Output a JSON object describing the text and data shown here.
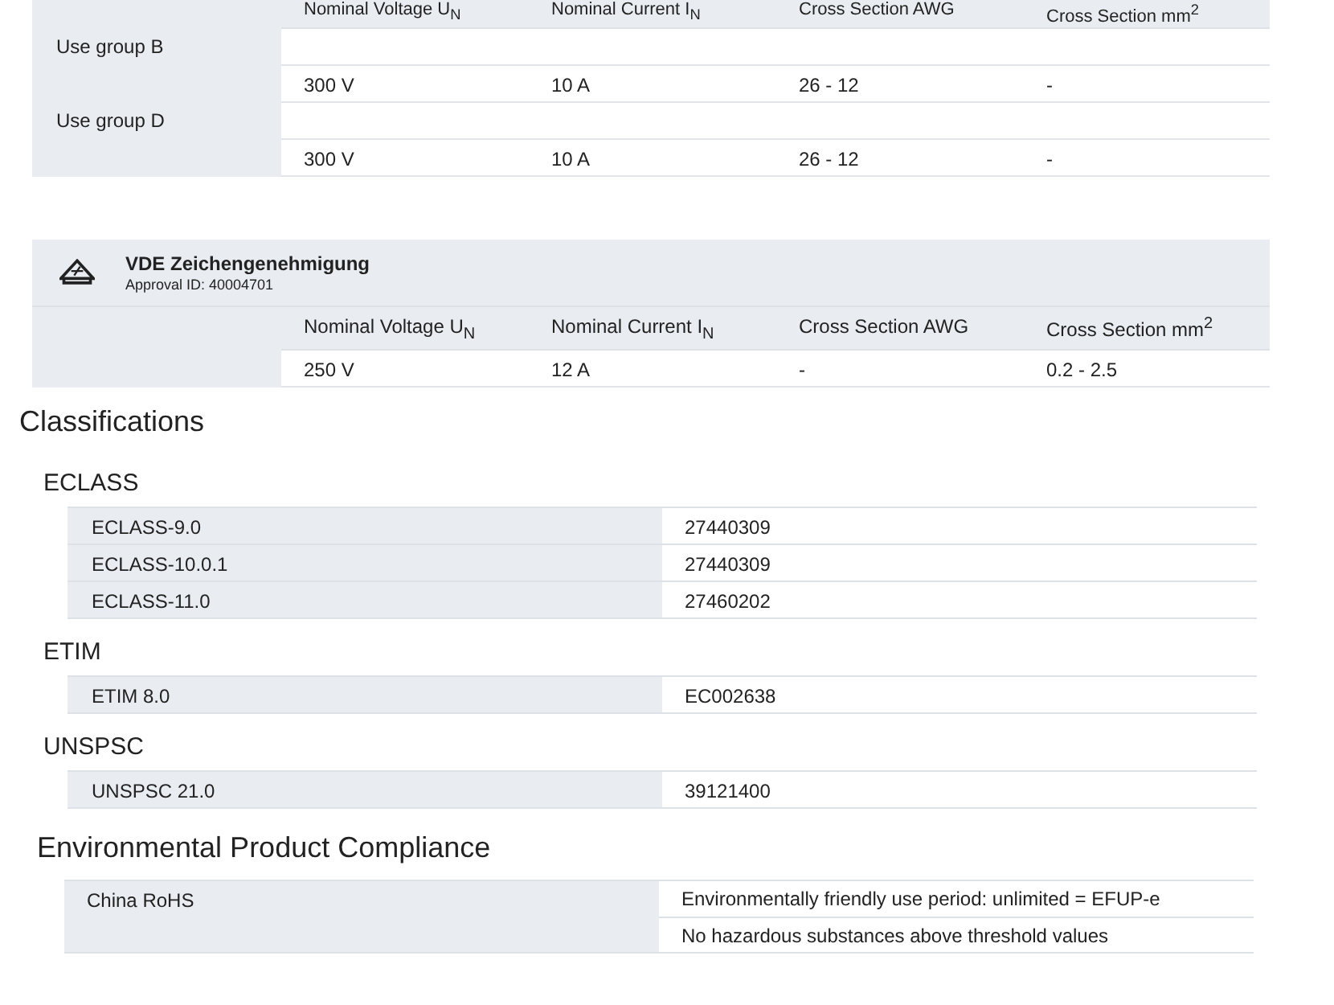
{
  "approvals": [
    {
      "columns": [
        "Nominal Voltage U$_{N}$",
        "Nominal Current I$_{N}$",
        "Cross Section AWG",
        "Cross Section mm$^{2}$"
      ],
      "groups": [
        {
          "name": "Use group B",
          "rows": [
            [
              "300 V",
              "10 A",
              "26 - 12",
              "-"
            ]
          ]
        },
        {
          "name": "Use group D",
          "rows": [
            [
              "300 V",
              "10 A",
              "26 - 12",
              "-"
            ]
          ]
        }
      ]
    },
    {
      "title": "VDE Zeichengenehmigung",
      "approval_id": "Approval ID: 40004701",
      "columns": [
        "Nominal Voltage U$_{N}$",
        "Nominal Current I$_{N}$",
        "Cross Section AWG",
        "Cross Section mm$^{2}$"
      ],
      "groups": [
        {
          "rows": [
            [
              "250 V",
              "12 A",
              "-",
              "0.2 - 2.5"
            ]
          ]
        }
      ]
    }
  ],
  "classifications": {
    "title": "Classifications",
    "groups": [
      {
        "name": "ECLASS",
        "rows": [
          {
            "label": "ECLASS-9.0",
            "value": "27440309"
          },
          {
            "label": "ECLASS-10.0.1",
            "value": "27440309"
          },
          {
            "label": "ECLASS-11.0",
            "value": "27460202"
          }
        ]
      },
      {
        "name": "ETIM",
        "rows": [
          {
            "label": "ETIM 8.0",
            "value": "EC002638"
          }
        ]
      },
      {
        "name": "UNSPSC",
        "rows": [
          {
            "label": "UNSPSC 21.0",
            "value": "39121400"
          }
        ]
      }
    ]
  },
  "compliance": {
    "title": "Environmental Product Compliance",
    "items": [
      {
        "label": "China RoHS",
        "values": [
          "Environmentally friendly use period: unlimited = EFUP-e",
          "No hazardous substances above threshold values"
        ]
      }
    ]
  }
}
